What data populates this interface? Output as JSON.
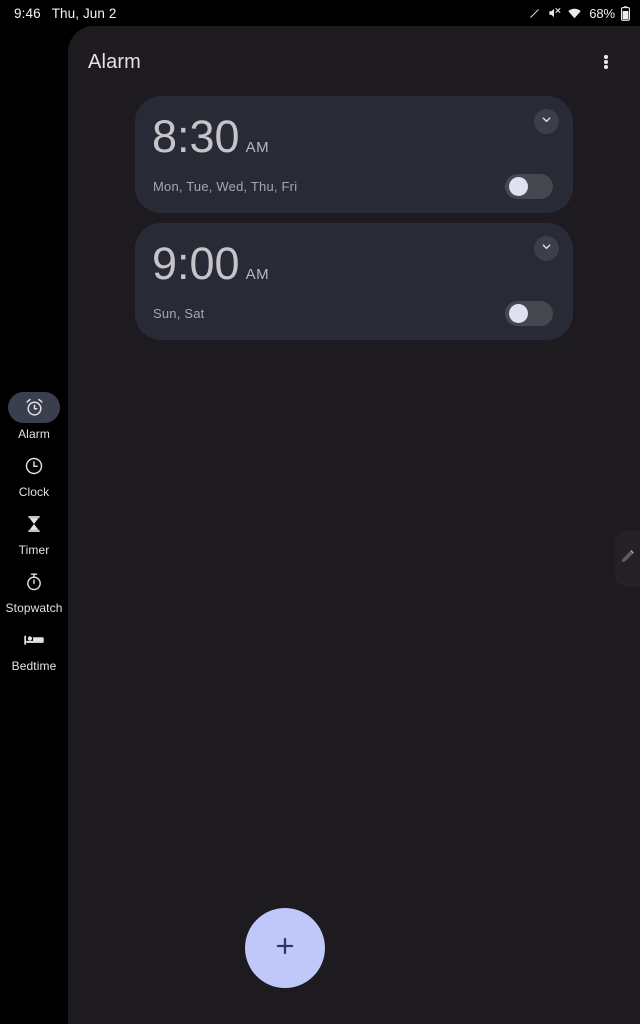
{
  "status_bar": {
    "time": "9:46",
    "date": "Thu, Jun 2",
    "battery_percent": "68%",
    "icons": [
      "stylus-icon",
      "volume-muted-icon",
      "wifi-icon",
      "battery-icon"
    ]
  },
  "app_bar": {
    "title": "Alarm",
    "overflow_menu": "more-options"
  },
  "rail": {
    "items": [
      {
        "label": "Alarm",
        "icon": "alarm-clock-icon",
        "selected": true
      },
      {
        "label": "Clock",
        "icon": "clock-icon",
        "selected": false
      },
      {
        "label": "Timer",
        "icon": "hourglass-icon",
        "selected": false
      },
      {
        "label": "Stopwatch",
        "icon": "stopwatch-icon",
        "selected": false
      },
      {
        "label": "Bedtime",
        "icon": "bed-icon",
        "selected": false
      }
    ]
  },
  "alarms": [
    {
      "time": "8:30",
      "ampm": "AM",
      "days": "Mon, Tue, Wed, Thu, Fri",
      "enabled": false,
      "expand_icon": "chevron-down-icon"
    },
    {
      "time": "9:00",
      "ampm": "AM",
      "days": "Sun, Sat",
      "enabled": false,
      "expand_icon": "chevron-down-icon"
    }
  ],
  "fab": {
    "label": "+",
    "icon": "plus-icon",
    "background": "#bfc8f8",
    "foreground": "#303466"
  },
  "edge_handle": {
    "icon": "stylus-pen-icon"
  },
  "colors": {
    "screen_background": "#000000",
    "pane_background": "#1d1b20",
    "card_background": "#282a35",
    "selected_pill": "#3a3f4d",
    "primary_text": "#e5e2e6",
    "secondary_text": "#a9a7ad",
    "time_text": "#c6c4c8",
    "switch_track_off": "#46474f",
    "switch_knob_off": "#e0e0f0"
  }
}
